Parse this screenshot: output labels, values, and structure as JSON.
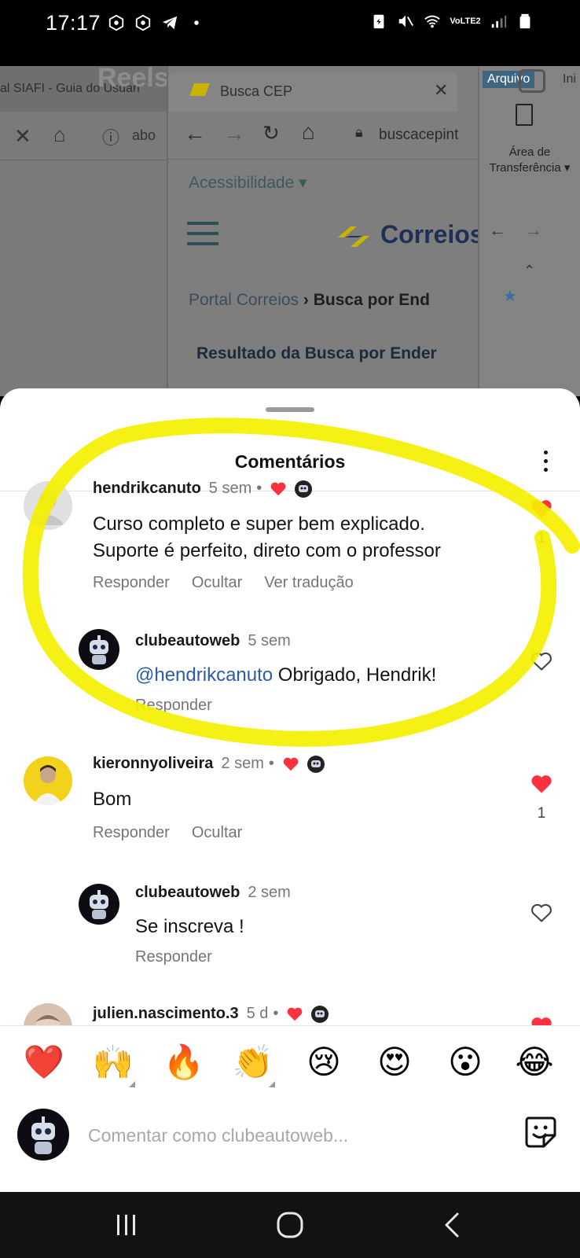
{
  "status_bar": {
    "time": "17:17",
    "left_icons": [
      "app-notification-icon",
      "app-notification-icon",
      "telegram-icon",
      "dot-icon"
    ],
    "right_icons": [
      "battery-saver-icon",
      "mute-icon",
      "wifi-icon",
      "volte-lte2-icon",
      "signal-icon",
      "battery-icon"
    ],
    "network_label": "VoLTE2"
  },
  "background_screenshot": {
    "left_tab_title": "al SIAFI - Guia do Usuári",
    "overlay_text": "Reels",
    "left_url": "abo",
    "tab_title": "Busca CEP",
    "url": "buscacepint",
    "accessibility_menu": "Acessibilidade",
    "logo_text": "Correios",
    "breadcrumb_portal": "Portal Correios",
    "breadcrumb_current": "Busca por End",
    "result_heading": "Resultado da Busca por Ender",
    "right_tab": "Arquivo",
    "right_tab_2": "Ini",
    "clipboard_label": "Área de Transferência"
  },
  "sheet": {
    "title": "Comentários"
  },
  "comments": [
    {
      "user": "hendrikcanuto",
      "time": "5 sem",
      "dot": "•",
      "text_line1": "Curso completo e super bem explicado.",
      "text_line2": "Suporte é perfeito, direto com o professor",
      "actions": [
        "Responder",
        "Ocultar",
        "Ver tradução"
      ],
      "likes": "1",
      "liked": true,
      "reply": {
        "user": "clubeautoweb",
        "time": "5 sem",
        "mention": "@hendrikcanuto",
        "text": " Obrigado, Hendrik!",
        "action": "Responder"
      }
    },
    {
      "user": "kieronnyoliveira",
      "time": "2 sem",
      "dot": "•",
      "text": "Bom",
      "actions": [
        "Responder",
        "Ocultar"
      ],
      "likes": "1",
      "liked": true,
      "reply": {
        "user": "clubeautoweb",
        "time": "2 sem",
        "text": "Se inscreva !",
        "action": "Responder"
      }
    },
    {
      "user": "julien.nascimento.3",
      "time": "5 d",
      "dot": "•",
      "liked": true
    }
  ],
  "emoji_bar": [
    "❤️",
    "🙌",
    "🔥",
    "👏",
    "😢",
    "😍",
    "😮",
    "😂"
  ],
  "composer": {
    "placeholder": "Comentar como clubeautoweb..."
  },
  "colors": {
    "accent_red": "#ff3040",
    "highlight_yellow": "#f5f000",
    "mention_blue": "#2a5caa",
    "nav_bar": "#121212"
  }
}
